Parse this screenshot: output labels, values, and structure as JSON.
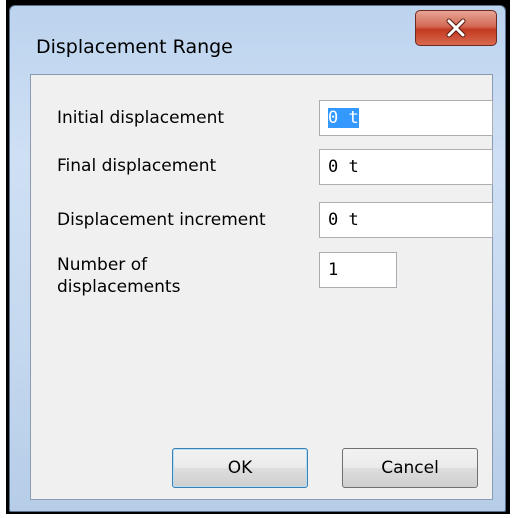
{
  "dialog": {
    "title": "Displacement Range",
    "close_glyph": "X"
  },
  "fields": [
    {
      "label": "Initial displacement",
      "value": "0 t"
    },
    {
      "label": "Final displacement",
      "value": "0 t"
    },
    {
      "label": "Displacement increment",
      "value": "0 t"
    },
    {
      "label_line1": "Number of",
      "label_line2": "displacements",
      "value": "1"
    }
  ],
  "buttons": {
    "ok": "OK",
    "cancel": "Cancel"
  },
  "colors": {
    "titlebar": "#c3d7ee",
    "close_button": "#c2391f",
    "selection": "#3399ff",
    "client_background": "#f0f0f0"
  }
}
